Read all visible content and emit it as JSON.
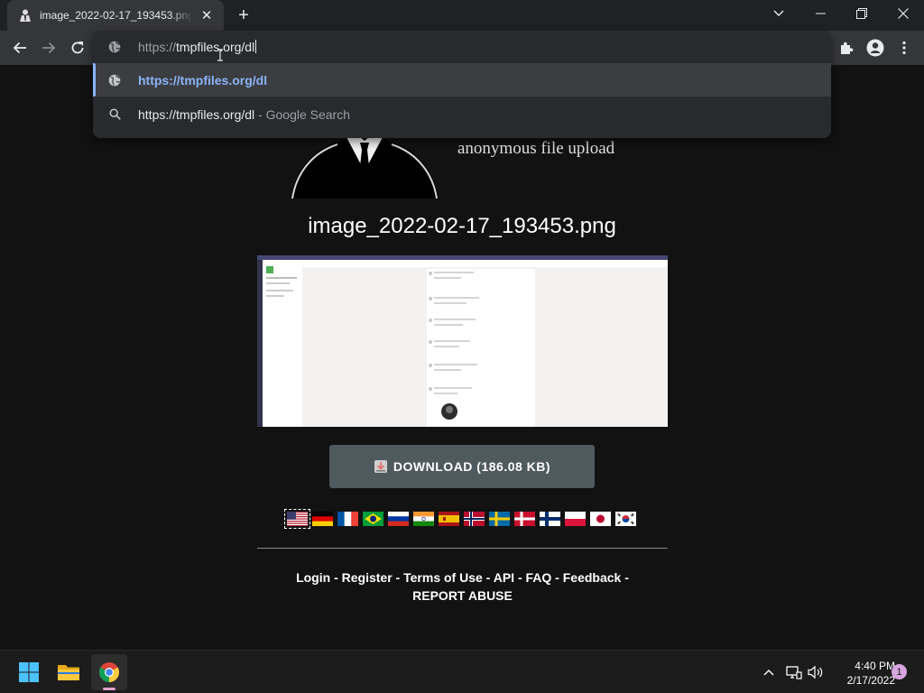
{
  "browser": {
    "tab_title": "image_2022-02-17_193453.png - ",
    "new_tab_symbol": "+",
    "close_tab_symbol": "✕",
    "accent_color": "#8ab4f8"
  },
  "omnibox": {
    "input_prefix": "https://",
    "input_host": "tmpfiles.org/dl",
    "suggestions": [
      {
        "text": "https://tmpfiles.org/dl",
        "icon": "globe-icon",
        "selected": true
      },
      {
        "text": "https://tmpfiles.org/dl",
        "suffix": " - Google Search",
        "icon": "search-icon",
        "selected": false
      }
    ]
  },
  "page": {
    "tagline": "anonymous file upload",
    "file_title": "image_2022-02-17_193453.png",
    "download_label": "DOWNLOAD (186.08 KB)",
    "languages": [
      "us",
      "de",
      "fr",
      "br",
      "ru",
      "in",
      "es",
      "no",
      "se",
      "dk",
      "fi",
      "pl",
      "jp",
      "kr"
    ],
    "footer": {
      "login": "Login",
      "register": "Register",
      "terms": "Terms of Use",
      "api": "API",
      "faq": "FAQ",
      "feedback": "Feedback",
      "report": "REPORT ABUSE",
      "sep": " - "
    }
  },
  "taskbar": {
    "time": "4:40 PM",
    "date": "2/17/2022",
    "notifications": "1"
  }
}
